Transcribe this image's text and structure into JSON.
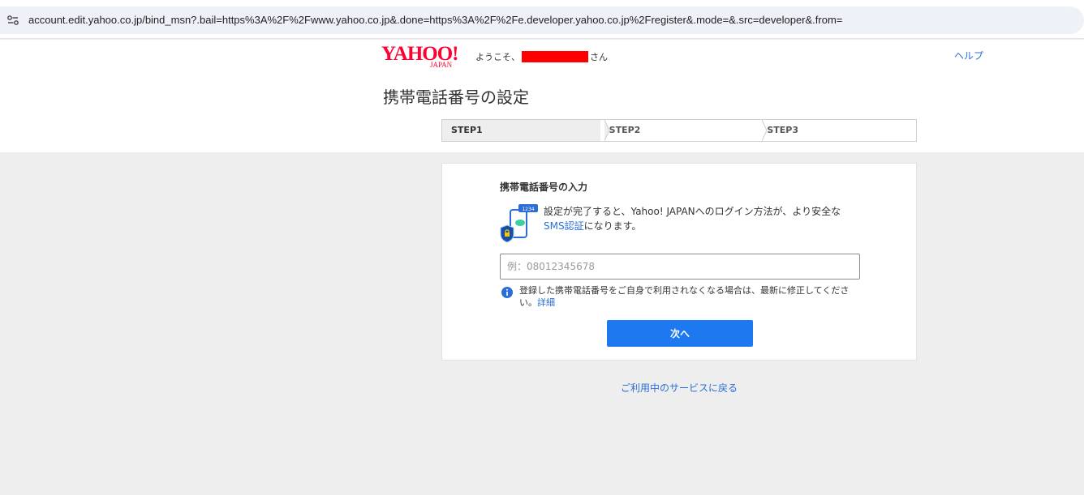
{
  "browser": {
    "url": "account.edit.yahoo.co.jp/bind_msn?.bail=https%3A%2F%2Fwww.yahoo.co.jp&.done=https%3A%2F%2Fe.developer.yahoo.co.jp%2Fregister&.mode=&.src=developer&.from="
  },
  "header": {
    "logo_main": "YAHOO!",
    "logo_sub": "JAPAN",
    "welcome_prefix": "ようこそ、",
    "welcome_suffix": "さん",
    "help_label": "ヘルプ",
    "page_title": "携帯電話番号の設定"
  },
  "steps": [
    {
      "label": "STEP1",
      "active": true
    },
    {
      "label": "STEP2",
      "active": false
    },
    {
      "label": "STEP3",
      "active": false
    }
  ],
  "card": {
    "title": "携帯電話番号の入力",
    "illustration_badge": "1234",
    "desc_line1": "設定が完了すると、Yahoo! JAPANへのログイン方法が、より安全な",
    "desc_link": "SMS認証",
    "desc_line2": "になります。",
    "input_placeholder": "例：08012345678",
    "input_value": "",
    "notice_text": "登録した携帯電話番号をご自身で利用されなくなる場合は、最新に修正してください。",
    "notice_link": "詳細",
    "next_button": "次へ"
  },
  "footer": {
    "back_link": "ご利用中のサービスに戻る"
  },
  "colors": {
    "brand": "#ff0033",
    "link": "#2b6fd6",
    "primary_button": "#1e78f0",
    "redaction": "#ff0000"
  }
}
